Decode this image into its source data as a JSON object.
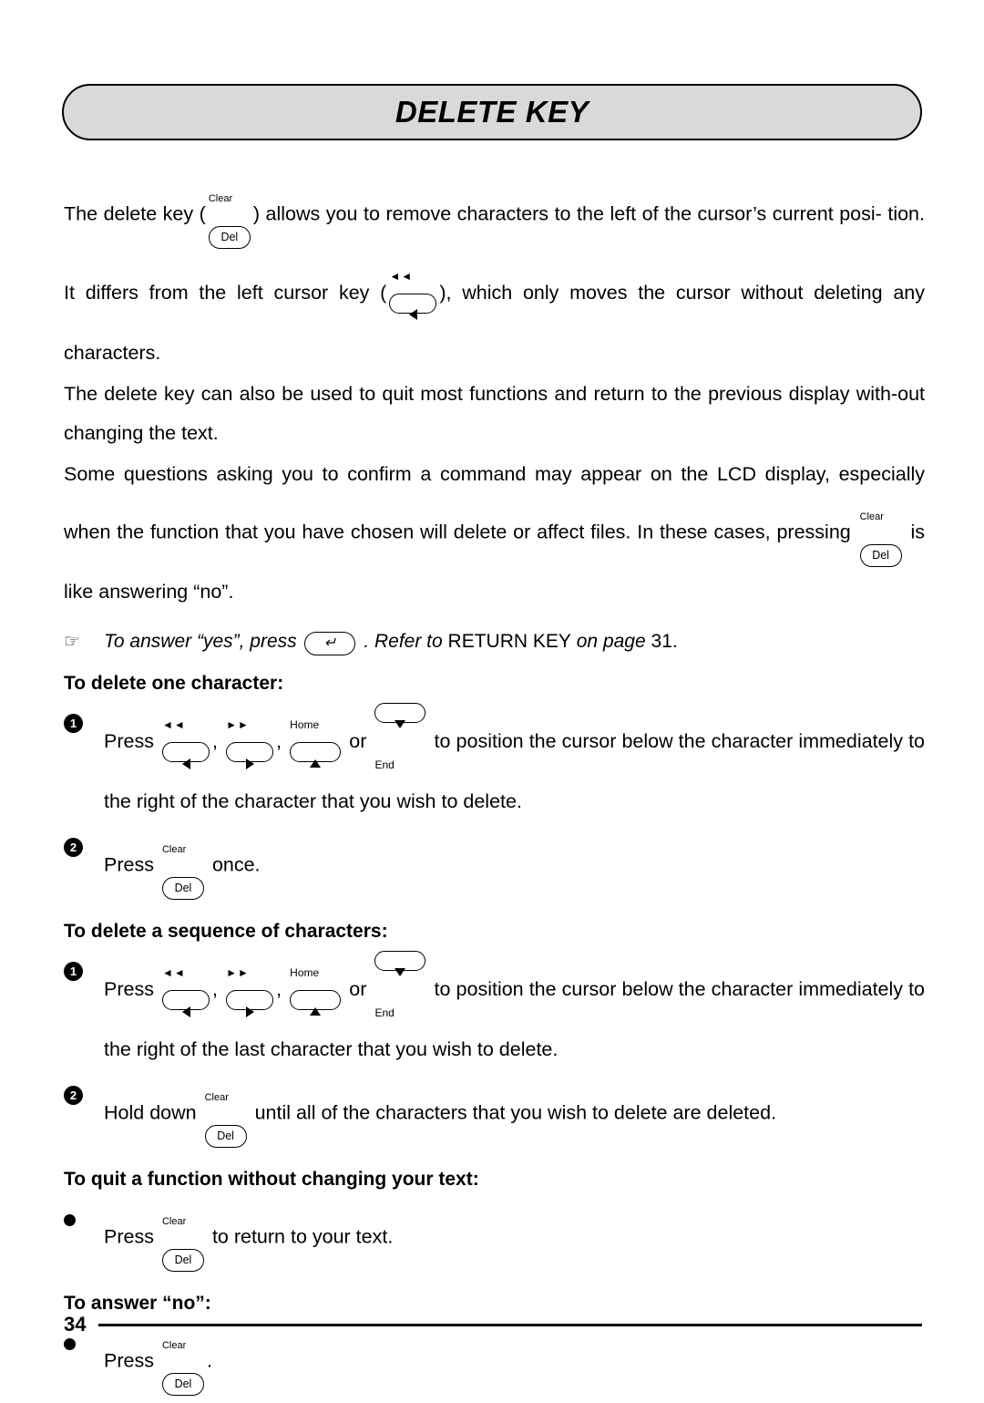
{
  "header": {
    "title": "DELETE KEY"
  },
  "keys": {
    "del": {
      "top": "Clear",
      "label": "Del"
    },
    "left": {
      "top": "◄◄",
      "glyph": "left-triangle"
    },
    "right": {
      "top": "►►",
      "glyph": "right-triangle"
    },
    "home_up": {
      "top": "Home",
      "glyph": "up-triangle"
    },
    "end_down": {
      "bottom": "End",
      "glyph": "down-triangle"
    },
    "return": {
      "glyph": "return-arrow"
    }
  },
  "paragraphs": {
    "p1_a": "The delete key (",
    "p1_b": ") allows you to remove characters to the left of the cursor’s current posi-",
    "p1_c": "tion. It differs from the left cursor key (",
    "p1_d": "), which only moves the cursor without deleting",
    "p1_e": "any characters.",
    "p2": "The delete key can also be used to quit most functions and return to the previous display with-out changing the text.",
    "p3_a": "Some questions asking you to confirm a command may appear on the LCD display, especially",
    "p3_b": "when the function that you have chosen will delete or affect files. In these cases, pressing",
    "p3_c": "is like answering “no”."
  },
  "note": {
    "hand_icon": "pointing-hand-icon",
    "text_a": "To answer “yes”, press",
    "text_b": ". Refer to",
    "text_c": "RETURN KEY",
    "text_d": "on page",
    "page": "31."
  },
  "sections": [
    {
      "heading": "To delete one character:",
      "steps": [
        {
          "marker": "1",
          "text_a": "Press",
          "sep1": ",",
          "sep2": ",",
          "text_or": "or",
          "text_b": "to position the cursor below the character immediately to the right of the character that you wish to delete."
        },
        {
          "marker": "2",
          "text_a": "Press",
          "text_b": "once."
        }
      ]
    },
    {
      "heading": "To delete a sequence of characters:",
      "steps": [
        {
          "marker": "1",
          "text_a": "Press",
          "sep1": ",",
          "sep2": ",",
          "text_or": "or",
          "text_b": "to position the cursor below the character immediately to the right of the last character that you wish to delete."
        },
        {
          "marker": "2",
          "text_a": "Hold down",
          "text_b": "until all of the characters that you wish to delete are deleted."
        }
      ]
    },
    {
      "heading": "To quit a function without changing your text:",
      "steps": [
        {
          "marker": "•",
          "text_a": "Press",
          "text_b": "to return to your text."
        }
      ]
    },
    {
      "heading": "To answer “no”:",
      "steps": [
        {
          "marker": "•",
          "text_a": "Press",
          "text_b": "."
        }
      ]
    }
  ],
  "footer": {
    "page_number": "34"
  }
}
